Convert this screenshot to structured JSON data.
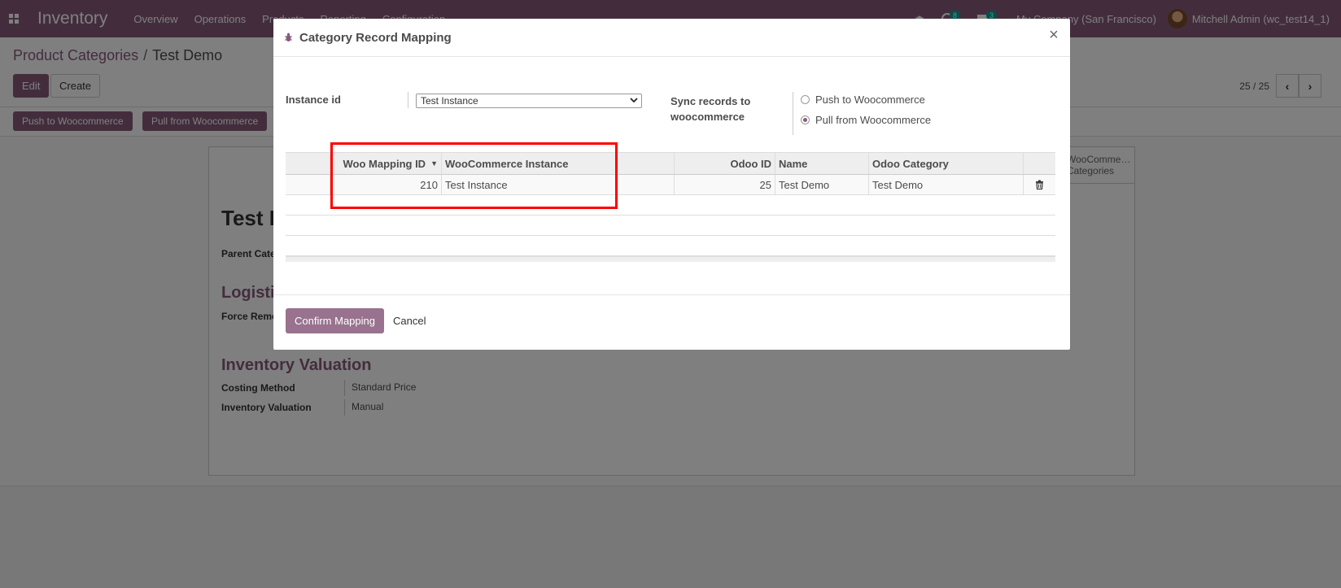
{
  "navbar": {
    "app_title": "Inventory",
    "menu": [
      "Overview",
      "Operations",
      "Products",
      "Reporting",
      "Configuration"
    ],
    "activity_count": "8",
    "messages_count": "3",
    "company": "My Company (San Francisco)",
    "user": "Mitchell Admin (wc_test14_1)",
    "accent_color": "#875a7b"
  },
  "control_panel": {
    "breadcrumb_parent": "Product Categories",
    "breadcrumb_current": "Test Demo",
    "edit_label": "Edit",
    "create_label": "Create",
    "pager_value": "25 / 25"
  },
  "statusbar": {
    "push_label": "Push to Woocommerce",
    "pull_label": "Pull from Woocommerce"
  },
  "form": {
    "smart_button_label": "WooComme… Categories",
    "title": "Test Demo",
    "parent_label": "Parent Category",
    "logistics_title": "Logistics",
    "force_removal_label": "Force Removal Strategy",
    "valuation_title": "Inventory Valuation",
    "costing_method_label": "Costing Method",
    "costing_method_value": "Standard Price",
    "inventory_valuation_label": "Inventory Valuation",
    "inventory_valuation_value": "Manual"
  },
  "modal": {
    "title": "Category Record Mapping",
    "close_label": "×",
    "instance_label": "Instance id",
    "instance_value": "Test Instance",
    "sync_label": "Sync records to woocommerce",
    "radio_options": [
      {
        "label": "Push to Woocommerce",
        "checked": false
      },
      {
        "label": "Pull from Woocommerce",
        "checked": true
      }
    ],
    "columns": [
      "Woo Mapping ID",
      "WooCommerce Instance",
      "Odoo ID",
      "Name",
      "Odoo Category"
    ],
    "rows": [
      {
        "woo_mapping_id": "210",
        "instance": "Test Instance",
        "odoo_id": "25",
        "name": "Test Demo",
        "category": "Test Demo"
      }
    ],
    "confirm_label": "Confirm Mapping",
    "cancel_label": "Cancel"
  }
}
